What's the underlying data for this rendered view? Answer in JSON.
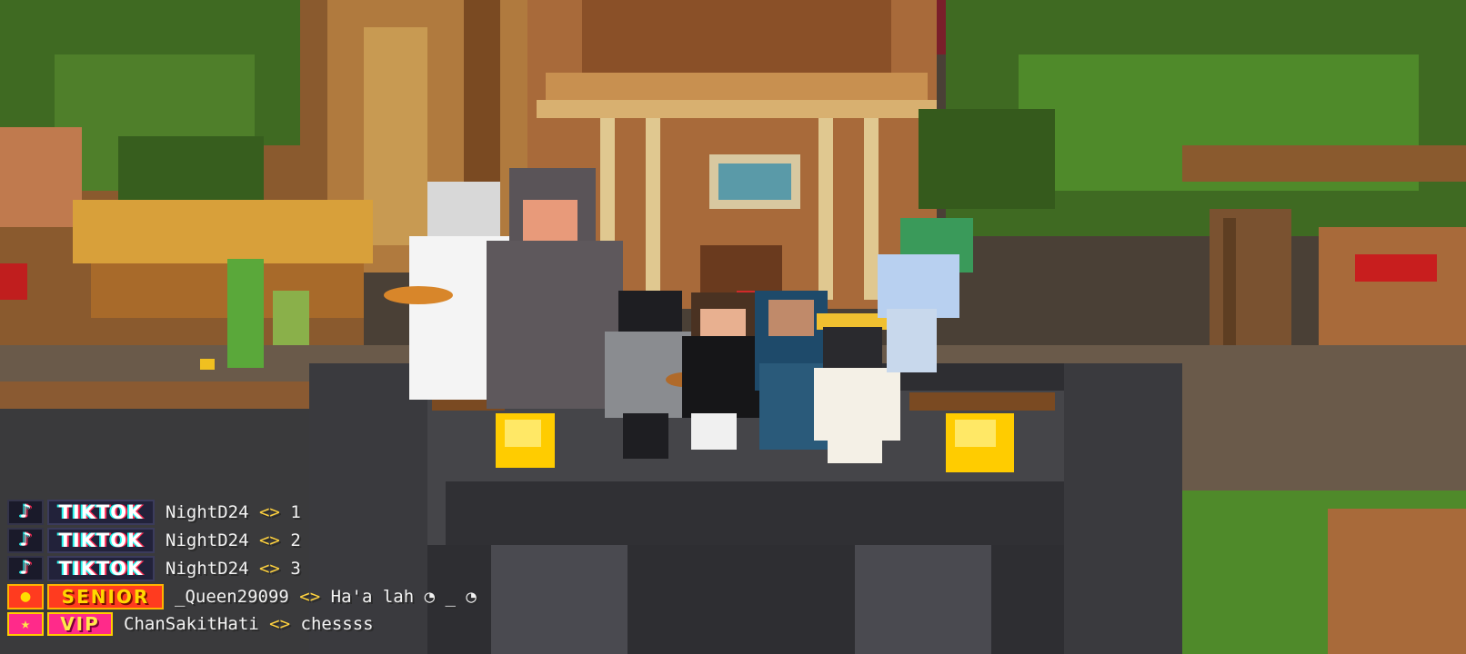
{
  "chat": {
    "lines": [
      {
        "badge": "TIKTOK",
        "player": "NightD24",
        "separator": "<>",
        "message": "1"
      },
      {
        "badge": "TIKTOK",
        "player": "NightD24",
        "separator": "<>",
        "message": "2"
      },
      {
        "badge": "TIKTOK",
        "player": "NightD24",
        "separator": "<>",
        "message": "3"
      },
      {
        "badge": "SENIOR",
        "player": "_Queen29099",
        "separator": "<>",
        "message": "Ha'a lah ◔ _ ◔"
      },
      {
        "badge": "VIP",
        "player": "ChanSakitHati",
        "separator": "<>",
        "message": "chessss"
      }
    ]
  },
  "icons": {
    "tiktok": "tiktok-note-icon",
    "senior": "gold-coin-icon",
    "vip": "star-icon"
  },
  "colors": {
    "tiktok_cyan": "#25f4ee",
    "tiktok_red": "#fe2c55",
    "senior_bg": "#ff3b1f",
    "senior_text": "#ffd800",
    "vip_bg": "#ff2a8a",
    "separator": "#ffd23f"
  }
}
